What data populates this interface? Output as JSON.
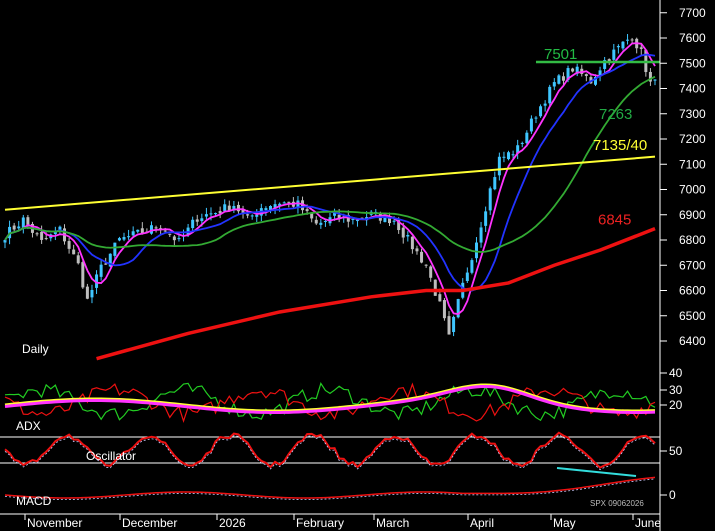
{
  "chart_data": {
    "type": "candlestick",
    "instrument_id": "SPX 09062026",
    "timeframe_label": "Daily",
    "x_months": [
      "November",
      "December",
      "2026",
      "February",
      "March",
      "April",
      "May",
      "June"
    ],
    "y_ticks": [
      6400,
      6500,
      6600,
      6700,
      6800,
      6900,
      7000,
      7100,
      7200,
      7300,
      7400,
      7500,
      7600,
      7700
    ],
    "ylim": [
      6300,
      7750
    ],
    "annotations": [
      {
        "text": "7501",
        "value": 7501,
        "color": "#22bb44"
      },
      {
        "text": "7263",
        "value": 7263,
        "color": "#22aa44"
      },
      {
        "text": "7135/40",
        "value": 7140,
        "color": "#ffff33"
      },
      {
        "text": "6845",
        "value": 6845,
        "color": "#ee2222"
      }
    ],
    "trendline": {
      "from": [
        0,
        6920
      ],
      "to": [
        142,
        7130
      ],
      "color": "#ffff33"
    },
    "resistance_line": {
      "value": 7505,
      "from": 116,
      "to": 143,
      "color": "#33bb44"
    },
    "ohlc_waypoints": [
      [
        0,
        6820
      ],
      [
        4,
        6880
      ],
      [
        8,
        6790
      ],
      [
        12,
        6840
      ],
      [
        16,
        6700
      ],
      [
        18,
        6560
      ],
      [
        21,
        6690
      ],
      [
        25,
        6800
      ],
      [
        30,
        6830
      ],
      [
        34,
        6860
      ],
      [
        38,
        6790
      ],
      [
        42,
        6890
      ],
      [
        46,
        6910
      ],
      [
        50,
        6940
      ],
      [
        53,
        6880
      ],
      [
        56,
        6930
      ],
      [
        60,
        6950
      ],
      [
        64,
        6940
      ],
      [
        68,
        6860
      ],
      [
        72,
        6890
      ],
      [
        76,
        6880
      ],
      [
        80,
        6900
      ],
      [
        85,
        6880
      ],
      [
        88,
        6800
      ],
      [
        92,
        6700
      ],
      [
        95,
        6540
      ],
      [
        97,
        6410
      ],
      [
        100,
        6620
      ],
      [
        103,
        6800
      ],
      [
        106,
        7000
      ],
      [
        108,
        7120
      ],
      [
        112,
        7160
      ],
      [
        116,
        7300
      ],
      [
        120,
        7420
      ],
      [
        124,
        7480
      ],
      [
        128,
        7430
      ],
      [
        131,
        7510
      ],
      [
        134,
        7560
      ],
      [
        137,
        7610
      ],
      [
        139,
        7540
      ],
      [
        141,
        7420
      ]
    ],
    "ma_series": [
      {
        "name": "ma-short",
        "color": "#ff33ff",
        "period": 5
      },
      {
        "name": "ma-mid",
        "color": "#2233ff",
        "period": 12
      },
      {
        "name": "ma-long",
        "color": "#33aa33",
        "period": 30
      },
      {
        "name": "ma-200",
        "color": "#ee1111",
        "values": [
          [
            20,
            6330
          ],
          [
            40,
            6430
          ],
          [
            60,
            6515
          ],
          [
            80,
            6575
          ],
          [
            92,
            6600
          ],
          [
            100,
            6600
          ],
          [
            110,
            6630
          ],
          [
            120,
            6700
          ],
          [
            130,
            6760
          ],
          [
            142,
            6845
          ]
        ]
      }
    ],
    "panels": [
      {
        "name": "ADX",
        "ticks": [
          40,
          30,
          20
        ]
      },
      {
        "name": "Oscillator",
        "ticks": [
          50
        ]
      },
      {
        "name": "MACD",
        "ticks": [
          0
        ]
      }
    ]
  }
}
